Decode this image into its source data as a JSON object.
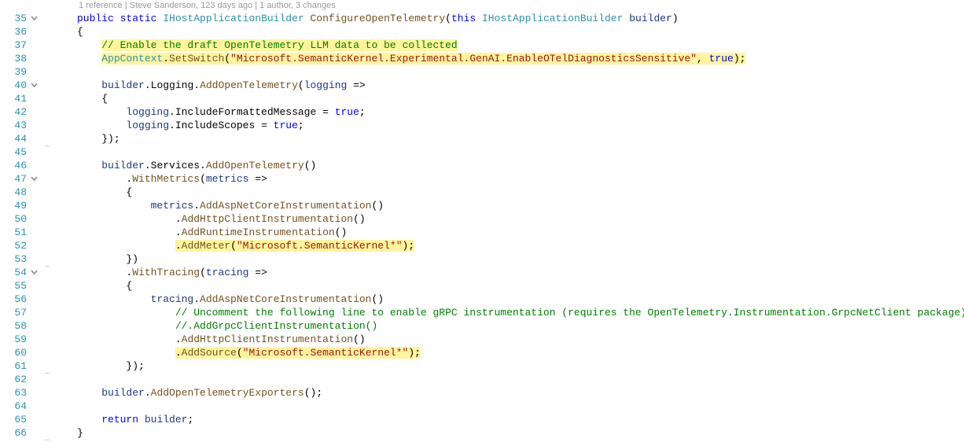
{
  "codelens": "1 reference | Steve Sanderson, 123 days ago | 1 author, 3 changes",
  "chevron": "v",
  "lines": {
    "35": {
      "num": "35"
    },
    "36": {
      "num": "36"
    },
    "37": {
      "num": "37"
    },
    "38": {
      "num": "38"
    },
    "39": {
      "num": "39"
    },
    "40": {
      "num": "40"
    },
    "41": {
      "num": "41"
    },
    "42": {
      "num": "42"
    },
    "43": {
      "num": "43"
    },
    "44": {
      "num": "44"
    },
    "45": {
      "num": "45"
    },
    "46": {
      "num": "46"
    },
    "47": {
      "num": "47"
    },
    "48": {
      "num": "48"
    },
    "49": {
      "num": "49"
    },
    "50": {
      "num": "50"
    },
    "51": {
      "num": "51"
    },
    "52": {
      "num": "52"
    },
    "53": {
      "num": "53"
    },
    "54": {
      "num": "54"
    },
    "55": {
      "num": "55"
    },
    "56": {
      "num": "56"
    },
    "57": {
      "num": "57"
    },
    "58": {
      "num": "58"
    },
    "59": {
      "num": "59"
    },
    "60": {
      "num": "60"
    },
    "61": {
      "num": "61"
    },
    "62": {
      "num": "62"
    },
    "63": {
      "num": "63"
    },
    "64": {
      "num": "64"
    },
    "65": {
      "num": "65"
    },
    "66": {
      "num": "66"
    }
  },
  "tok": {
    "public": "public",
    "static": "static",
    "this": "this",
    "true": "true",
    "return": "return",
    "type_IHostApplicationBuilder": "IHostApplicationBuilder",
    "method_ConfigureOpenTelemetry": "ConfigureOpenTelemetry",
    "param_builder": "builder",
    "brace_open": "{",
    "brace_close": "}",
    "paren_open": "(",
    "paren_close": ")",
    "semi": ";",
    "comma": ",",
    "dot": ".",
    "arrow": "=>",
    "eq": " = ",
    "comment_enable": "// Enable the draft OpenTelemetry LLM data to be collected",
    "AppContext": "AppContext",
    "SetSwitch": "SetSwitch",
    "str_switch": "\"Microsoft.SemanticKernel.Experimental.GenAI.EnableOTelDiagnosticsSensitive\"",
    "prop_Logging": "Logging",
    "AddOpenTelemetry": "AddOpenTelemetry",
    "param_logging": "logging",
    "IncludeFormattedMessage": "IncludeFormattedMessage",
    "IncludeScopes": "IncludeScopes",
    "prop_Services": "Services",
    "WithMetrics": "WithMetrics",
    "param_metrics": "metrics",
    "AddAspNetCoreInstrumentation": "AddAspNetCoreInstrumentation",
    "AddHttpClientInstrumentation": "AddHttpClientInstrumentation",
    "AddRuntimeInstrumentation": "AddRuntimeInstrumentation",
    "AddMeter": "AddMeter",
    "str_sk": "\"Microsoft.SemanticKernel*\"",
    "WithTracing": "WithTracing",
    "param_tracing": "tracing",
    "comment_grpc1": "// Uncomment the following line to enable gRPC instrumentation (requires the OpenTelemetry.Instrumentation.GrpcNetClient package)",
    "comment_grpc2": "//.AddGrpcClientInstrumentation()",
    "AddSource": "AddSource",
    "AddOpenTelemetryExporters": "AddOpenTelemetryExporters"
  }
}
